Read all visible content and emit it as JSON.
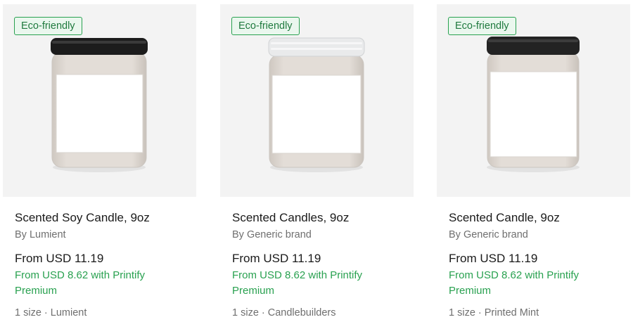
{
  "products": [
    {
      "badge": "Eco-friendly",
      "title": "Scented Soy Candle, 9oz",
      "brand": "By Lumient",
      "price": "From USD 11.19",
      "premium_price": "From USD 8.62 with Printify Premium",
      "meta": "1 size · Lumient",
      "lid_color": "#1c1c1c"
    },
    {
      "badge": "Eco-friendly",
      "title": "Scented Candles, 9oz",
      "brand": "By Generic brand",
      "price": "From USD 11.19",
      "premium_price": "From USD 8.62 with Printify Premium",
      "meta": "1 size · Candlebuilders",
      "lid_color": "#e9eaeb"
    },
    {
      "badge": "Eco-friendly",
      "title": "Scented Candle, 9oz",
      "brand": "By Generic brand",
      "price": "From USD 11.19",
      "premium_price": "From USD 8.62 with Printify Premium",
      "meta": "1 size · Printed Mint",
      "lid_color": "#232323"
    }
  ],
  "colors": {
    "badge_border": "#29a150",
    "premium_text": "#29a150",
    "thumb_background": "#f3f3f3"
  }
}
